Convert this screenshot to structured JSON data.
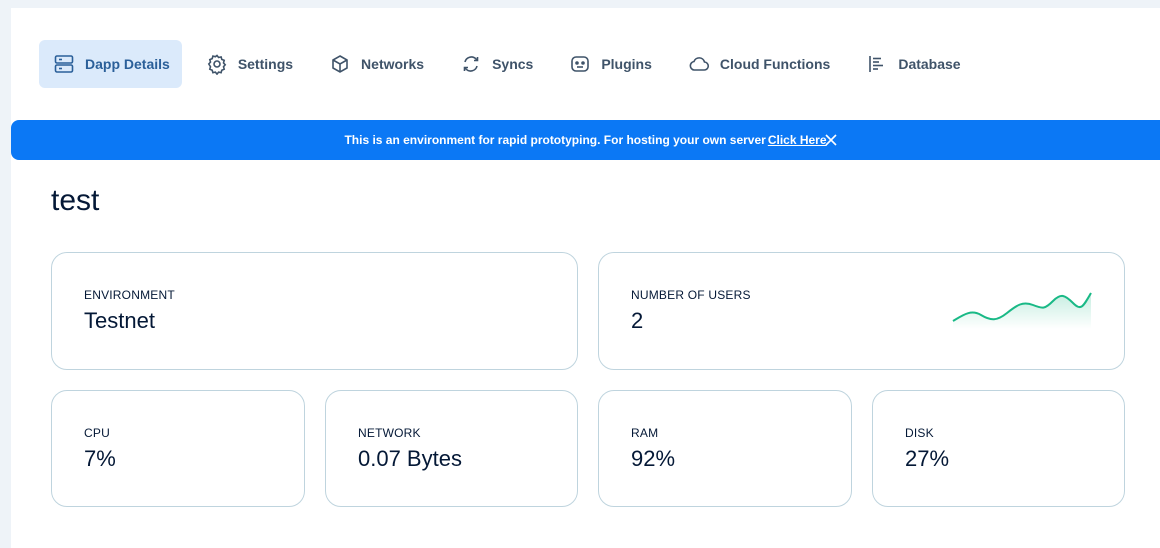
{
  "tabs": [
    {
      "label": "Dapp Details",
      "icon": "server-icon",
      "active": true
    },
    {
      "label": "Settings",
      "icon": "gear-icon",
      "active": false
    },
    {
      "label": "Networks",
      "icon": "cube-icon",
      "active": false
    },
    {
      "label": "Syncs",
      "icon": "sync-icon",
      "active": false
    },
    {
      "label": "Plugins",
      "icon": "plugin-icon",
      "active": false
    },
    {
      "label": "Cloud Functions",
      "icon": "cloud-icon",
      "active": false
    },
    {
      "label": "Database",
      "icon": "database-icon",
      "active": false
    }
  ],
  "banner": {
    "text": "This is an environment for rapid prototyping. For hosting your own server",
    "link": "Click Here"
  },
  "dapp": {
    "title": "test"
  },
  "stats": {
    "environment": {
      "label": "ENVIRONMENT",
      "value": "Testnet"
    },
    "users": {
      "label": "NUMBER OF USERS",
      "value": "2"
    },
    "cpu": {
      "label": "CPU",
      "value": "7%"
    },
    "network": {
      "label": "NETWORK",
      "value": "0.07 Bytes"
    },
    "ram": {
      "label": "RAM",
      "value": "92%"
    },
    "disk": {
      "label": "DISK",
      "value": "27%"
    }
  },
  "colors": {
    "accent": "#0b78f5",
    "active_tab_bg": "#dbeafb",
    "sparkline": "#19b986"
  }
}
